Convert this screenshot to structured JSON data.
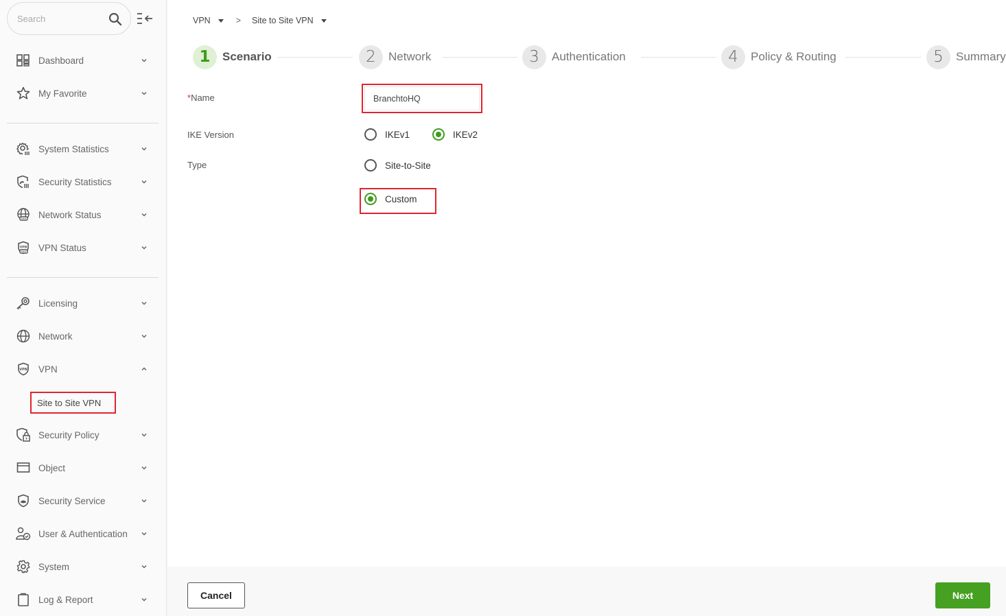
{
  "sidebar": {
    "search_placeholder": "Search",
    "items": [
      {
        "label": "Dashboard",
        "icon": "dashboard-icon",
        "expanded": false
      },
      {
        "label": "My Favorite",
        "icon": "star-icon",
        "expanded": false
      },
      {
        "label": "System Statistics",
        "icon": "system-statistics-icon",
        "expanded": false
      },
      {
        "label": "Security Statistics",
        "icon": "security-statistics-icon",
        "expanded": false
      },
      {
        "label": "Network Status",
        "icon": "network-status-icon",
        "expanded": false
      },
      {
        "label": "VPN Status",
        "icon": "vpn-status-icon",
        "expanded": false
      },
      {
        "label": "Licensing",
        "icon": "key-icon",
        "expanded": false
      },
      {
        "label": "Network",
        "icon": "globe-icon",
        "expanded": false
      },
      {
        "label": "VPN",
        "icon": "vpn-shield-icon",
        "expanded": true
      },
      {
        "label": "Security Policy",
        "icon": "security-policy-icon",
        "expanded": false
      },
      {
        "label": "Object",
        "icon": "object-icon",
        "expanded": false
      },
      {
        "label": "Security Service",
        "icon": "security-service-icon",
        "expanded": false
      },
      {
        "label": "User & Authentication",
        "icon": "user-auth-icon",
        "expanded": false
      },
      {
        "label": "System",
        "icon": "gear-icon",
        "expanded": false
      },
      {
        "label": "Log & Report",
        "icon": "clipboard-icon",
        "expanded": false
      }
    ],
    "vpn_subitems": [
      {
        "label": "Site to Site VPN",
        "selected": true
      }
    ]
  },
  "breadcrumb": [
    {
      "label": "VPN"
    },
    {
      "label": "Site to Site VPN"
    }
  ],
  "breadcrumb_separator": ">",
  "wizard": {
    "steps": [
      {
        "number": "1",
        "label": "Scenario",
        "active": true
      },
      {
        "number": "2",
        "label": "Network",
        "active": false
      },
      {
        "number": "3",
        "label": "Authentication",
        "active": false
      },
      {
        "number": "4",
        "label": "Policy & Routing",
        "active": false
      },
      {
        "number": "5",
        "label": "Summary",
        "active": false
      }
    ]
  },
  "form": {
    "name_required_mark": "*",
    "name_label": "Name",
    "name_value": "BranchtoHQ",
    "ike_label": "IKE Version",
    "ike_options": [
      {
        "label": "IKEv1",
        "checked": false
      },
      {
        "label": "IKEv2",
        "checked": true
      }
    ],
    "type_label": "Type",
    "type_options": [
      {
        "label": "Site-to-Site",
        "checked": false
      },
      {
        "label": "Custom",
        "checked": true
      }
    ]
  },
  "footer": {
    "cancel_label": "Cancel",
    "next_label": "Next"
  },
  "colors": {
    "accent_green": "#46a021",
    "active_step_bg": "#dff0d4",
    "highlight_red": "#e0242c"
  }
}
